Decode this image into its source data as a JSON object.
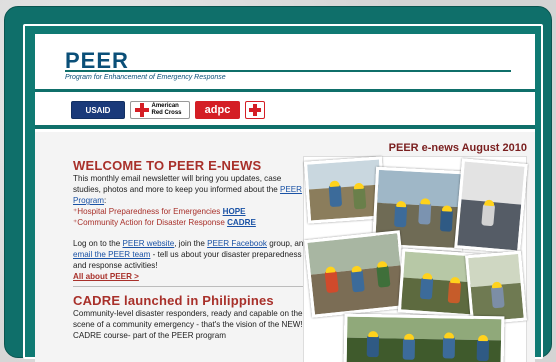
{
  "brand": {
    "title": "PEER",
    "subtitle": "Program for Enhancement of Emergency Response"
  },
  "logos": [
    "USAID",
    "American Red Cross",
    "adpc",
    "IFRC"
  ],
  "issue": "PEER e-news   August 2010",
  "welcome": {
    "heading": "WELCOME TO PEER E-NEWS",
    "intro": "This monthly email newsletter will bring you updates, case studies, photos and more to keep you informed about the",
    "program_link": "PEER Program",
    "colon": ":",
    "item1_text": "Hospital Preparedness for Emergencies",
    "item1_link": "HOPE",
    "item2_text": "Community Action for Disaster Response",
    "item2_link": "CADRE",
    "log_on": "Log on to the",
    "website_link": "PEER website",
    "join_text": ", join the",
    "facebook_link": "PEER Facebook",
    "group_text": "group, and",
    "email_link": "email the PEER team",
    "tell_text": "- tell us about your disaster preparedness and response activities!",
    "all_about": "All about PEER >"
  },
  "cadre": {
    "heading": "CADRE launched in Philippines",
    "text": "Community-level disaster responders, ready and capable on the scene of a community emergency - that's the vision of the NEW! CADRE course- part of the PEER program"
  }
}
